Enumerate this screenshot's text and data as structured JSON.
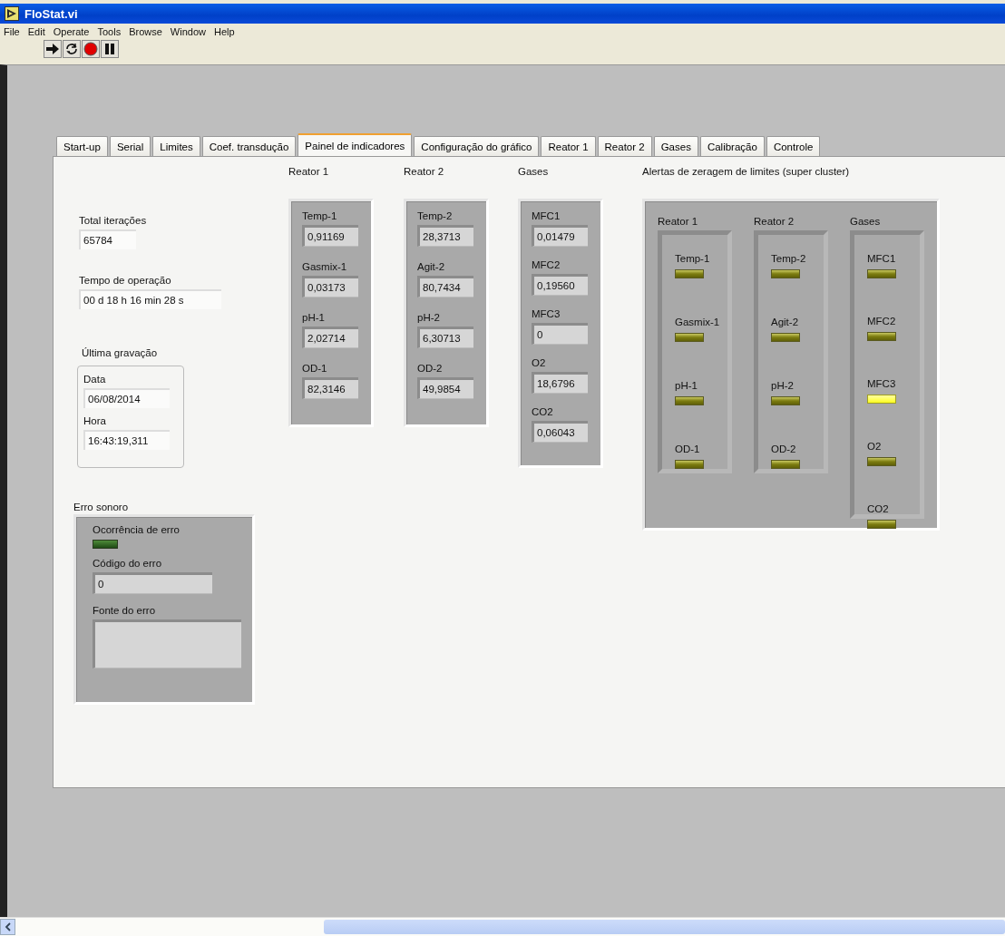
{
  "window": {
    "title": "FloStat.vi"
  },
  "menu": [
    "File",
    "Edit",
    "Operate",
    "Tools",
    "Browse",
    "Window",
    "Help"
  ],
  "tabs": [
    {
      "label": "Start-up",
      "selected": false
    },
    {
      "label": "Serial",
      "selected": false
    },
    {
      "label": "Limites",
      "selected": false
    },
    {
      "label": "Coef. transdução",
      "selected": false
    },
    {
      "label": "Painel de indicadores",
      "selected": true
    },
    {
      "label": "Configuração do gráfico",
      "selected": false
    },
    {
      "label": "Reator 1",
      "selected": false
    },
    {
      "label": "Reator 2",
      "selected": false
    },
    {
      "label": "Gases",
      "selected": false
    },
    {
      "label": "Calibração",
      "selected": false
    },
    {
      "label": "Controle",
      "selected": false
    }
  ],
  "total_iteracoes": {
    "label": "Total iterações",
    "value": "65784"
  },
  "tempo_operacao": {
    "label": "Tempo de operação",
    "value": "00 d 18 h 16 min 28 s"
  },
  "ultima_gravacao": {
    "title": "Última gravação",
    "fields": [
      {
        "label": "Data",
        "value": "06/08/2014"
      },
      {
        "label": "Hora",
        "value": "16:43:19,311"
      }
    ]
  },
  "erro_sonoro": {
    "title": "Erro sonoro",
    "ocorrencia": {
      "label": "Ocorrência de erro",
      "on": false
    },
    "codigo": {
      "label": "Código do erro",
      "value": "0"
    },
    "fonte": {
      "label": "Fonte do erro"
    }
  },
  "clusters": [
    {
      "title": "Reator 1",
      "items": [
        {
          "label": "Temp-1",
          "value": "0,91169"
        },
        {
          "label": "Gasmix-1",
          "value": "0,03173"
        },
        {
          "label": "pH-1",
          "value": "2,02714"
        },
        {
          "label": "OD-1",
          "value": "82,3146"
        }
      ]
    },
    {
      "title": "Reator 2",
      "items": [
        {
          "label": "Temp-2",
          "value": "28,3713"
        },
        {
          "label": "Agit-2",
          "value": "80,7434"
        },
        {
          "label": "pH-2",
          "value": "6,30713"
        },
        {
          "label": "OD-2",
          "value": "49,9854"
        }
      ]
    },
    {
      "title": "Gases",
      "items": [
        {
          "label": "MFC1",
          "value": "0,01479"
        },
        {
          "label": "MFC2",
          "value": "0,19560"
        },
        {
          "label": "MFC3",
          "value": "0"
        },
        {
          "label": "O2",
          "value": "18,6796"
        },
        {
          "label": "CO2",
          "value": "0,06043"
        }
      ]
    }
  ],
  "alertas": {
    "title": "Alertas de zeragem de limites (super cluster)",
    "groups": [
      {
        "title": "Reator 1",
        "leds": [
          {
            "label": "Temp-1",
            "on": false
          },
          {
            "label": "Gasmix-1",
            "on": false
          },
          {
            "label": "pH-1",
            "on": false
          },
          {
            "label": "OD-1",
            "on": false
          }
        ]
      },
      {
        "title": "Reator 2",
        "leds": [
          {
            "label": "Temp-2",
            "on": false
          },
          {
            "label": "Agit-2",
            "on": false
          },
          {
            "label": "pH-2",
            "on": false
          },
          {
            "label": "OD-2",
            "on": false
          }
        ]
      },
      {
        "title": "Gases",
        "leds": [
          {
            "label": "MFC1",
            "on": false
          },
          {
            "label": "MFC2",
            "on": false
          },
          {
            "label": "MFC3",
            "on": true
          },
          {
            "label": "O2",
            "on": false
          },
          {
            "label": "CO2",
            "on": false
          }
        ]
      }
    ]
  }
}
